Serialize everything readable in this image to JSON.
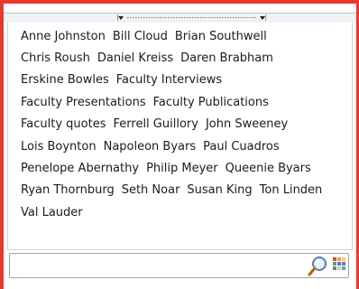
{
  "tag_cloud": {
    "lines": [
      [
        "Anne Johnston",
        "Bill Cloud",
        "Brian Southwell"
      ],
      [
        "Chris Roush",
        "Daniel Kreiss",
        "Daren Brabham"
      ],
      [
        "Erskine Bowles",
        "Faculty Interviews"
      ],
      [
        "Faculty Presentations",
        "Faculty Publications"
      ],
      [
        "Faculty quotes",
        "Ferrell Guillory",
        "John Sweeney"
      ],
      [
        "Lois Boynton",
        "Napoleon Byars",
        "Paul Cuadros"
      ],
      [
        "Penelope Abernathy",
        "Philip Meyer",
        "Queenie Byars"
      ],
      [
        "Ryan Thornburg",
        "Seth Noar",
        "Susan King",
        "Ton Linden"
      ],
      [
        "Val Lauder"
      ]
    ]
  },
  "search": {
    "value": "",
    "placeholder": "",
    "icon": "search-icon",
    "secondary_icon": "color-grid-icon"
  },
  "colors": {
    "frame_border": "#e8392b",
    "splitter_bg": "#eef1f6",
    "text": "#1b1b1b",
    "color_grid": [
      "#d94a3a",
      "#e8a33a",
      "#f1d449",
      "#5aa55a",
      "#4a7fd1",
      "#a15ac7",
      "#7a7a7a",
      "#c9c9c9",
      "#3ab8c8"
    ]
  }
}
